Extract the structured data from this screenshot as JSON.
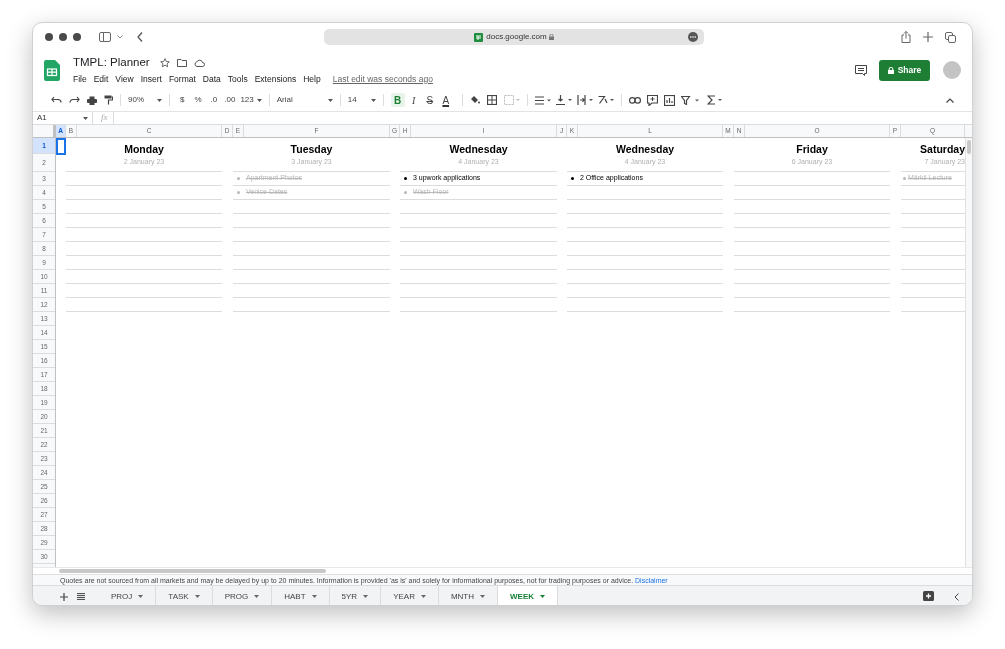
{
  "browser": {
    "url": "docs.google.com"
  },
  "doc": {
    "title": "TMPL: Planner",
    "menu": [
      "File",
      "Edit",
      "View",
      "Insert",
      "Format",
      "Data",
      "Tools",
      "Extensions",
      "Help"
    ],
    "last_edit": "Last edit was seconds ago",
    "share": "Share"
  },
  "toolbar": {
    "zoom": "90%",
    "currency": "$",
    "percent": "%",
    "decrease_decimal": ".0",
    "increase_decimal": ".00",
    "number_format": "123",
    "font": "Arial",
    "font_size": "14",
    "format_buttons": [
      {
        "kind": "bold",
        "label": "B",
        "selected": true
      },
      {
        "kind": "italic",
        "label": "I",
        "selected": false
      },
      {
        "kind": "strike",
        "label": "S",
        "selected": false
      },
      {
        "kind": "color",
        "label": "A",
        "selected": false
      }
    ]
  },
  "formula_bar": {
    "name_box": "A1",
    "fx": "fx"
  },
  "columns": [
    {
      "letter": "A",
      "selected": true
    },
    {
      "letter": "B",
      "selected": false
    },
    {
      "letter": "C",
      "selected": false
    },
    {
      "letter": "D",
      "selected": false
    },
    {
      "letter": "E",
      "selected": false
    },
    {
      "letter": "F",
      "selected": false
    },
    {
      "letter": "G",
      "selected": false
    },
    {
      "letter": "H",
      "selected": false
    },
    {
      "letter": "I",
      "selected": false
    },
    {
      "letter": "J",
      "selected": false
    },
    {
      "letter": "K",
      "selected": false
    },
    {
      "letter": "L",
      "selected": false
    },
    {
      "letter": "M",
      "selected": false
    },
    {
      "letter": "N",
      "selected": false
    },
    {
      "letter": "O",
      "selected": false
    },
    {
      "letter": "P",
      "selected": false
    },
    {
      "letter": "Q",
      "selected": false
    }
  ],
  "rows": [
    {
      "number": "1",
      "selected": true
    },
    {
      "number": "2",
      "selected": false
    },
    {
      "number": "3",
      "selected": false
    },
    {
      "number": "4",
      "selected": false
    },
    {
      "number": "5",
      "selected": false
    },
    {
      "number": "6",
      "selected": false
    },
    {
      "number": "7",
      "selected": false
    },
    {
      "number": "8",
      "selected": false
    },
    {
      "number": "9",
      "selected": false
    },
    {
      "number": "10",
      "selected": false
    },
    {
      "number": "11",
      "selected": false
    },
    {
      "number": "12",
      "selected": false
    },
    {
      "number": "13",
      "selected": false
    },
    {
      "number": "14",
      "selected": false
    },
    {
      "number": "15",
      "selected": false
    },
    {
      "number": "16",
      "selected": false
    },
    {
      "number": "17",
      "selected": false
    },
    {
      "number": "18",
      "selected": false
    },
    {
      "number": "19",
      "selected": false
    },
    {
      "number": "20",
      "selected": false
    },
    {
      "number": "21",
      "selected": false
    },
    {
      "number": "22",
      "selected": false
    },
    {
      "number": "23",
      "selected": false
    },
    {
      "number": "24",
      "selected": false
    },
    {
      "number": "25",
      "selected": false
    },
    {
      "number": "26",
      "selected": false
    },
    {
      "number": "27",
      "selected": false
    },
    {
      "number": "28",
      "selected": false
    },
    {
      "number": "29",
      "selected": false
    },
    {
      "number": "30",
      "selected": false
    }
  ],
  "days": [
    {
      "title": "Monday",
      "date": "2 January 23"
    },
    {
      "title": "Tuesday",
      "date": "3 January 23",
      "tasks": [
        {
          "text": "Apartment Photos",
          "done": true
        },
        {
          "text": "Venice Dates",
          "done": true
        }
      ]
    },
    {
      "title": "Wednesday",
      "date": "4 January 23",
      "tasks": [
        {
          "text": "3 upwork applications",
          "done": false
        },
        {
          "text": "Wash Floor",
          "done": true
        }
      ]
    },
    {
      "title": "Wednesday",
      "date": "4 January 23",
      "tasks": [
        {
          "text": "2 Office applications",
          "done": false
        }
      ]
    },
    {
      "title": "Friday",
      "date": "6 January 23"
    },
    {
      "title": "Saturday",
      "date": "7 January 23",
      "tasks": [
        {
          "text": "Märkli Lecture",
          "done": true
        }
      ]
    }
  ],
  "disclaimer": {
    "text": "Quotes are not sourced from all markets and may be delayed by up to 20 minutes. Information is provided 'as is' and solely for informational purposes, not for trading purposes or advice.",
    "link": "Disclaimer"
  },
  "sheet_tabs": [
    {
      "label": "PROJ",
      "selected": false
    },
    {
      "label": "TASK",
      "selected": false
    },
    {
      "label": "PROG",
      "selected": false
    },
    {
      "label": "HABT",
      "selected": false
    },
    {
      "label": "5YR",
      "selected": false
    },
    {
      "label": "YEAR",
      "selected": false
    },
    {
      "label": "MNTH",
      "selected": false
    },
    {
      "label": "WEEK",
      "selected": true
    }
  ]
}
